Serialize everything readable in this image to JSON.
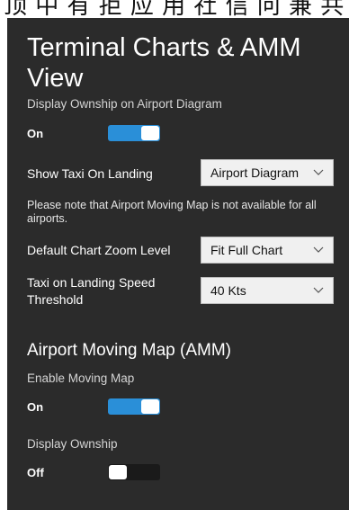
{
  "clipped_header": "顶 中 有 拒 应 用 社 信 问 兼 共 出",
  "page": {
    "title": "Terminal Charts & AMM View"
  },
  "terminal": {
    "display_ownship_label": "Display Ownship on Airport Diagram",
    "display_ownship_state": "On",
    "display_ownship_on": true,
    "show_taxi_label": "Show Taxi On Landing",
    "show_taxi_value": "Airport Diagram",
    "note": "Please note that Airport Moving Map is not available for all airports.",
    "zoom_label": "Default Chart Zoom Level",
    "zoom_value": "Fit Full Chart",
    "speed_label": "Taxi on Landing Speed Threshold",
    "speed_value": "40 Kts"
  },
  "amm": {
    "section_title": "Airport Moving Map (AMM)",
    "enable_label": "Enable Moving Map",
    "enable_state": "On",
    "enable_on": true,
    "ownship_label": "Display Ownship",
    "ownship_state": "Off",
    "ownship_on": false
  },
  "colors": {
    "panel_bg": "#2b2b2b",
    "toggle_on": "#2a8fd8",
    "toggle_off": "#1a1a1a",
    "select_bg": "#f0f0f0"
  },
  "icons": {
    "dropdown": "chevron-down-icon"
  }
}
